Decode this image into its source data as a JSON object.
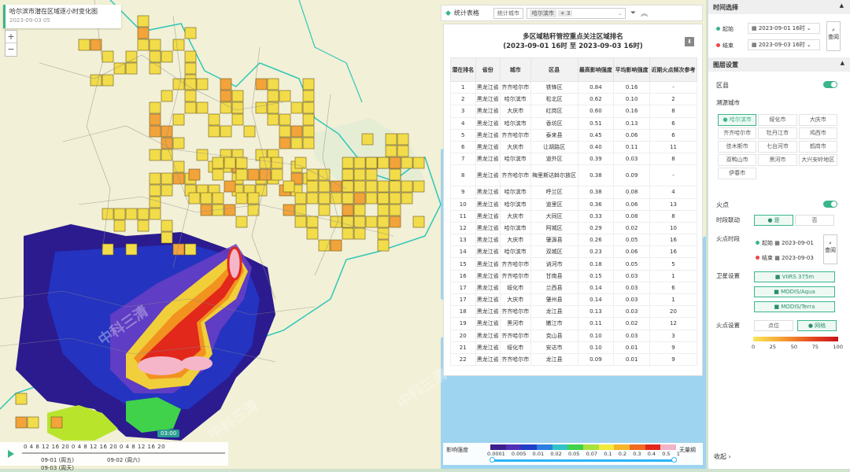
{
  "map": {
    "title": "哈尔滨市潜在区域逐小时变化图",
    "date": "2023-09-03 05",
    "zoom_in": "+",
    "zoom_out": "−",
    "timeline": {
      "hours": [
        "0",
        "4",
        "8",
        "12",
        "16",
        "20",
        "0",
        "4",
        "8",
        "12",
        "16",
        "20",
        "0",
        "4",
        "8",
        "12",
        "16",
        "20"
      ],
      "days": [
        "09-01 (周五)",
        "09-02 (周六)",
        "09-03 (周天)"
      ],
      "current": "03:00"
    },
    "legend": {
      "label": "影响强度",
      "values": [
        "0.0001",
        "0.005",
        "0.01",
        "0.02",
        "0.05",
        "0.07",
        "0.1",
        "0.2",
        "0.3",
        "0.4",
        "0.5",
        "1"
      ],
      "colors": [
        "#3c1f8c",
        "#4f2fb3",
        "#1f3fc8",
        "#2a7fe0",
        "#2fc3c8",
        "#3fd24a",
        "#a8e23a",
        "#f4e83a",
        "#f6b52a",
        "#ef6b1f",
        "#e2271b",
        "#f3b3c6"
      ],
      "none_label": "无量纲"
    },
    "watermark": "中科三清"
  },
  "stats": {
    "header_label": "统计表格",
    "city_label": "统计城市",
    "selected_chip": "哈尔滨市",
    "more_chip": "+ 3",
    "title_line1": "多区域秸秆管控重点关注区域排名",
    "title_line2": "(2023-09-01 16时 至 2023-09-03 16时)",
    "columns": [
      "潜在排名",
      "省份",
      "城市",
      "区县",
      "最高影响强度",
      "平均影响强度",
      "近期火点频次参考"
    ],
    "rows": [
      [
        "1",
        "黑龙江省",
        "齐齐哈尔市",
        "铁锋区",
        "0.84",
        "0.16",
        "-"
      ],
      [
        "2",
        "黑龙江省",
        "哈尔滨市",
        "松北区",
        "0.62",
        "0.10",
        "2"
      ],
      [
        "3",
        "黑龙江省",
        "大庆市",
        "红岗区",
        "0.60",
        "0.16",
        "8"
      ],
      [
        "4",
        "黑龙江省",
        "哈尔滨市",
        "香坊区",
        "0.51",
        "0.13",
        "6"
      ],
      [
        "5",
        "黑龙江省",
        "齐齐哈尔市",
        "泰来县",
        "0.45",
        "0.06",
        "6"
      ],
      [
        "6",
        "黑龙江省",
        "大庆市",
        "让胡路区",
        "0.40",
        "0.11",
        "11"
      ],
      [
        "7",
        "黑龙江省",
        "哈尔滨市",
        "道外区",
        "0.39",
        "0.03",
        "8"
      ],
      [
        "8",
        "黑龙江省",
        "齐齐哈尔市",
        "梅里斯达斡尔族区",
        "0.38",
        "0.09",
        "-"
      ],
      [
        "9",
        "黑龙江省",
        "哈尔滨市",
        "呼兰区",
        "0.38",
        "0.08",
        "4"
      ],
      [
        "10",
        "黑龙江省",
        "哈尔滨市",
        "道里区",
        "0.36",
        "0.06",
        "13"
      ],
      [
        "11",
        "黑龙江省",
        "大庆市",
        "大同区",
        "0.33",
        "0.08",
        "8"
      ],
      [
        "12",
        "黑龙江省",
        "哈尔滨市",
        "阿城区",
        "0.29",
        "0.02",
        "10"
      ],
      [
        "13",
        "黑龙江省",
        "大庆市",
        "肇源县",
        "0.26",
        "0.05",
        "16"
      ],
      [
        "14",
        "黑龙江省",
        "哈尔滨市",
        "双城区",
        "0.23",
        "0.06",
        "16"
      ],
      [
        "15",
        "黑龙江省",
        "齐齐哈尔市",
        "讷河市",
        "0.18",
        "0.05",
        "5"
      ],
      [
        "16",
        "黑龙江省",
        "齐齐哈尔市",
        "甘南县",
        "0.15",
        "0.03",
        "1"
      ],
      [
        "17",
        "黑龙江省",
        "绥化市",
        "兰西县",
        "0.14",
        "0.03",
        "6"
      ],
      [
        "17",
        "黑龙江省",
        "大庆市",
        "肇州县",
        "0.14",
        "0.03",
        "1"
      ],
      [
        "18",
        "黑龙江省",
        "齐齐哈尔市",
        "龙江县",
        "0.13",
        "0.03",
        "20"
      ],
      [
        "19",
        "黑龙江省",
        "黑河市",
        "嫩江市",
        "0.11",
        "0.02",
        "12"
      ],
      [
        "20",
        "黑龙江省",
        "齐齐哈尔市",
        "克山县",
        "0.10",
        "0.03",
        "3"
      ],
      [
        "21",
        "黑龙江省",
        "绥化市",
        "安达市",
        "0.10",
        "0.01",
        "9"
      ],
      [
        "22",
        "黑龙江省",
        "齐齐哈尔市",
        "龙江县",
        "0.09",
        "0.01",
        "9"
      ]
    ]
  },
  "sidebar": {
    "time_section": "时间选择",
    "start_label": "起始",
    "start_date": "2023-09-01",
    "start_hour": "16时",
    "end_label": "结束",
    "end_date": "2023-09-03",
    "end_hour": "16时",
    "query": "查阅",
    "layer_section": "图层设置",
    "county_label": "区县",
    "source_city_label": "溯源城市",
    "cities": [
      "哈尔滨市",
      "绥化市",
      "大庆市",
      "齐齐哈尔市",
      "牡丹江市",
      "鸡西市",
      "佳木斯市",
      "七台河市",
      "鹤岗市",
      "双鸭山市",
      "黑河市",
      "大兴安岭地区",
      "伊春市"
    ],
    "fire_label": "火点",
    "link_label": "时段联动",
    "link_yes": "是",
    "link_no": "否",
    "fire_period_label": "火点时段",
    "fire_start_label": "起始",
    "fire_start_date": "2023-09-01",
    "fire_end_label": "结束",
    "fire_end_date": "2023-09-03",
    "satellite_label": "卫星设置",
    "satellites": [
      "VIIRS 375m",
      "MODIS/Aqua",
      "MODIS/Terra"
    ],
    "fire_set_label": "火点设置",
    "point_label": "点位",
    "grid_label": "网格",
    "scale": [
      "0",
      "25",
      "50",
      "75",
      "100"
    ],
    "collapse": "收起 ›"
  }
}
